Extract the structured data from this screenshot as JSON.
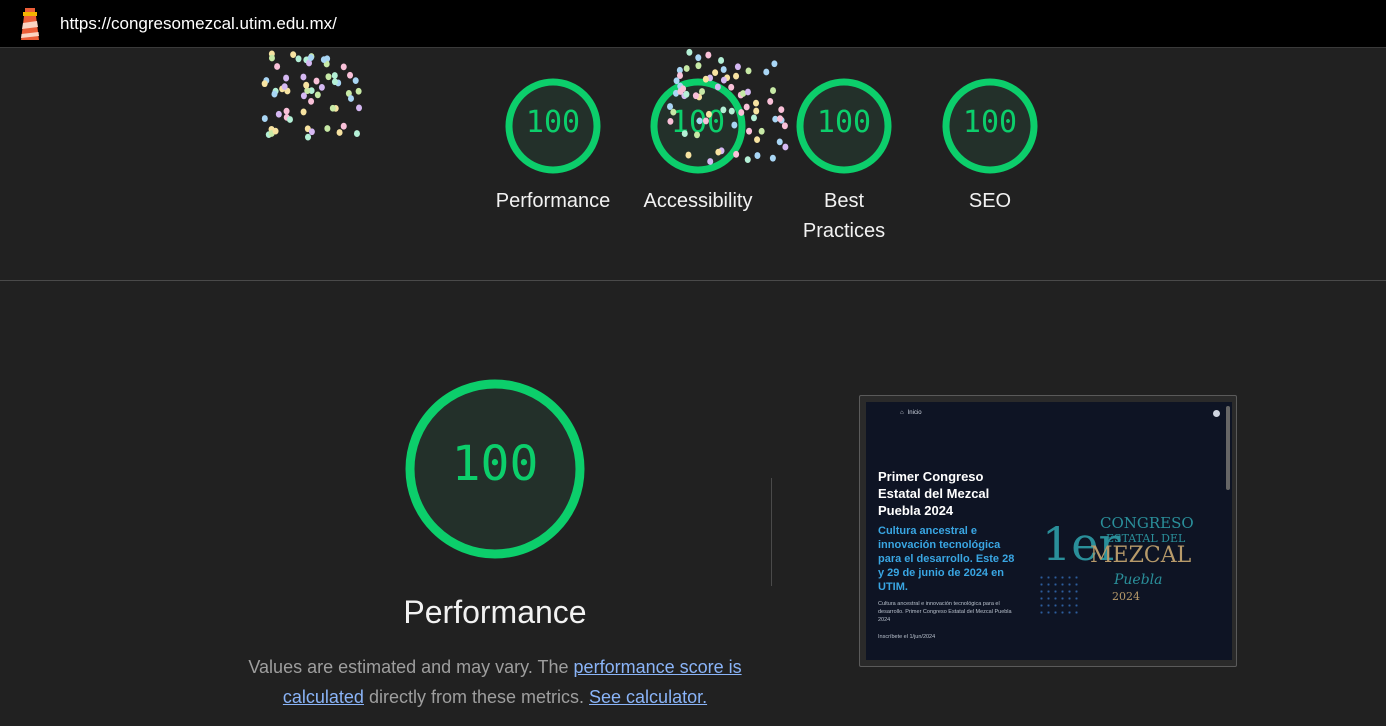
{
  "header": {
    "url": "https://congresomezcal.utim.edu.mx/",
    "logo_icon": "lighthouse-icon"
  },
  "categories": [
    {
      "score": "100",
      "label": "Performance",
      "value": 100
    },
    {
      "score": "100",
      "label": "Accessibility",
      "value": 100
    },
    {
      "score": "100",
      "label": "Best Practices",
      "value": 100
    },
    {
      "score": "100",
      "label": "SEO",
      "value": 100
    }
  ],
  "performance": {
    "score": "100",
    "value": 100,
    "title": "Performance",
    "desc_prefix": "Values are estimated and may vary. The ",
    "link_score": "performance score is calculated",
    "desc_middle": " directly from these metrics. ",
    "link_calc": "See calculator."
  },
  "colors": {
    "pass": "#0cce6b",
    "background": "#212121",
    "link": "#8ab4f8"
  },
  "screenshot": {
    "nav_label": "Inicio",
    "title": "Primer Congreso Estatal del Mezcal Puebla 2024",
    "subtitle": "Cultura ancestral e innovación tecnológica para el desarrollo. Este 28 y 29 de junio de 2024 en UTIM.",
    "body": "Cultura ancestral e innovación tecnológica para el desarrollo. Primer Congreso Estatal del Mezcal Puebla 2024",
    "cta": "Inscríbete el 1/jun/2024",
    "logo_text_1": "1er",
    "logo_text_2": "CONGRESO",
    "logo_text_3": "ESTATAL DEL",
    "logo_text_4": "MEZCAL",
    "logo_text_5": "Puebla",
    "logo_text_6": "2024"
  }
}
